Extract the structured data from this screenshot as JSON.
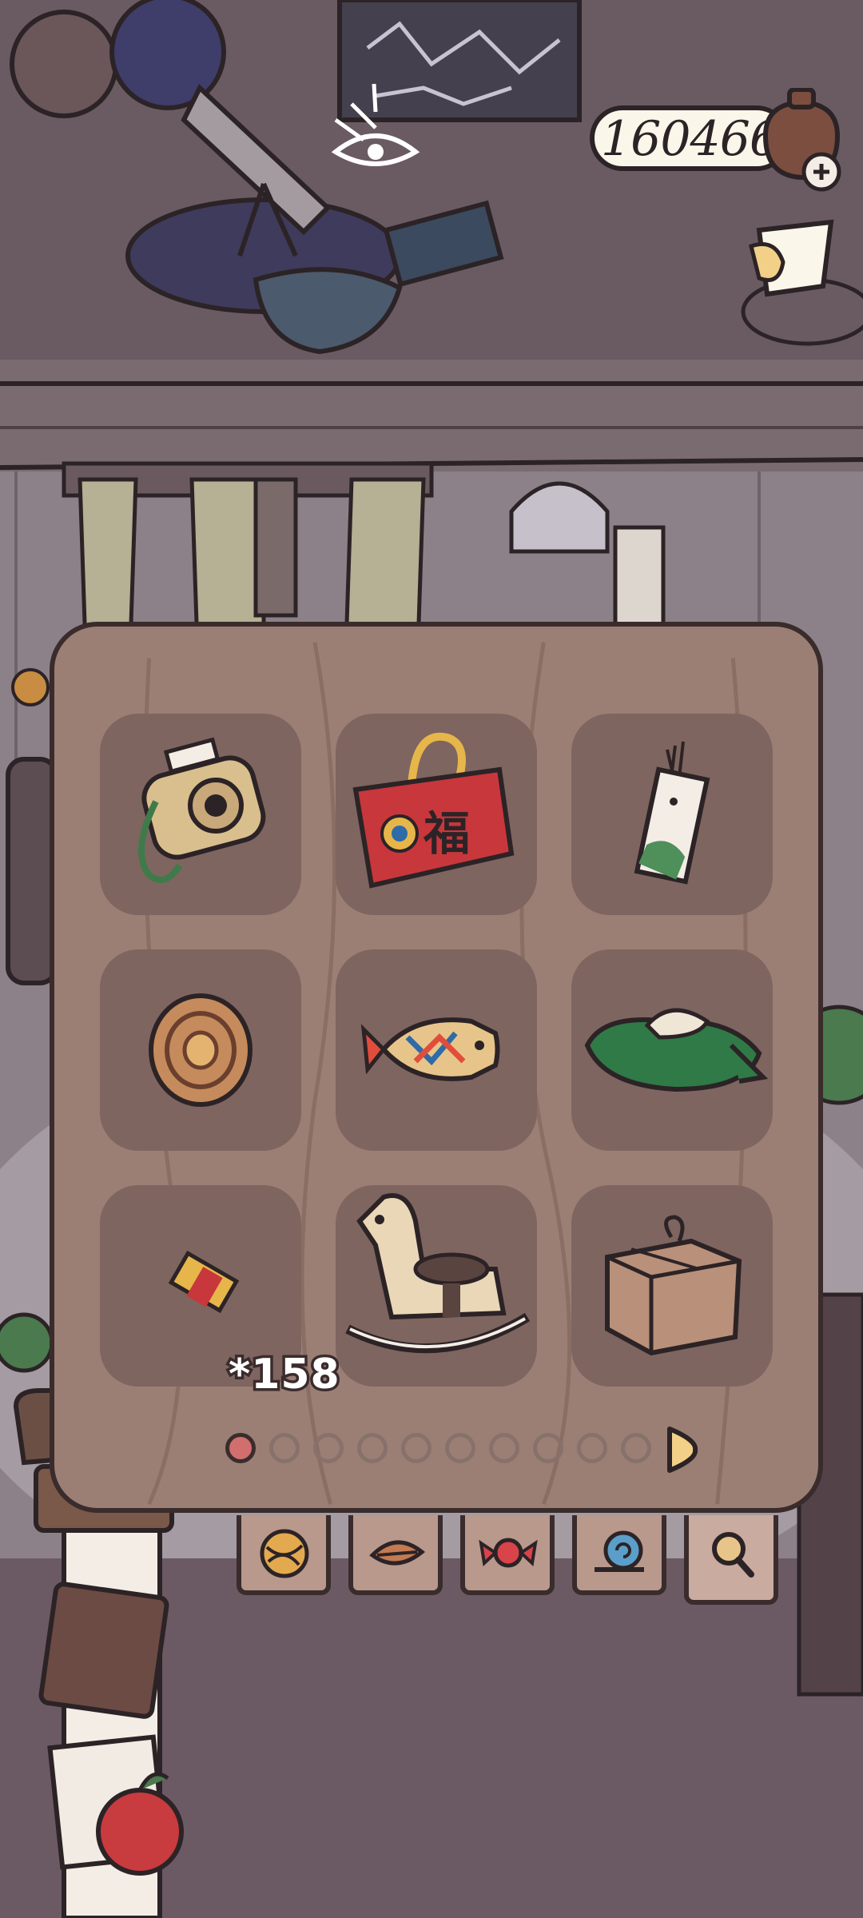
{
  "currency": {
    "amount": "160466",
    "icon": "acorn-bag-icon",
    "add_icon": "plus-icon"
  },
  "side_button": {
    "icon": "paper-cup-icon"
  },
  "inventory": {
    "items": [
      {
        "name": "instant-camera",
        "icon": "camera-icon"
      },
      {
        "name": "lucky-bag",
        "icon": "lucky-bag-icon",
        "glyph": "福"
      },
      {
        "name": "bookmark-charm",
        "icon": "bookmark-icon"
      },
      {
        "name": "swirl-cookie",
        "icon": "cookie-icon"
      },
      {
        "name": "taiyaki",
        "icon": "fish-cake-icon"
      },
      {
        "name": "green-bundle",
        "icon": "bundle-icon"
      },
      {
        "name": "ticket",
        "icon": "ticket-icon",
        "count": "*158"
      },
      {
        "name": "rocking-horse",
        "icon": "rocking-horse-icon"
      },
      {
        "name": "parcel-box",
        "icon": "box-icon"
      }
    ],
    "pagination": {
      "total": 10,
      "current": 1
    }
  },
  "tabs": [
    {
      "icon": "yarn-ball-icon"
    },
    {
      "icon": "leaf-icon"
    },
    {
      "icon": "candy-icon"
    },
    {
      "icon": "snail-icon"
    },
    {
      "icon": "magnifier-icon",
      "active": true
    }
  ],
  "colors": {
    "panel": "#9b7f74",
    "slot": "#7e6560",
    "outline": "#3a2c2c",
    "active_dot": "#d16e6e"
  }
}
